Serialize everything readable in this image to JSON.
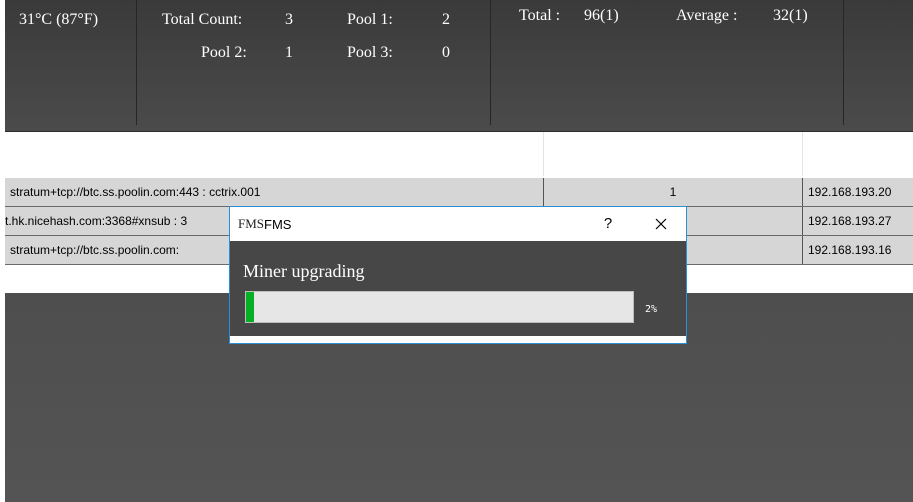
{
  "stats": {
    "temperature": "31°C (87°F)",
    "total_count_label": "Total Count:",
    "total_count_value": "3",
    "pool1_label": "Pool 1:",
    "pool1_value": "2",
    "pool2_label": "Pool 2:",
    "pool2_value": "1",
    "pool3_label": "Pool 3:",
    "pool3_value": "0",
    "total_label": "Total :",
    "total_value": "96(1)",
    "average_label": "Average :",
    "average_value": "32(1)"
  },
  "rows": [
    {
      "pool": "stratum+tcp://btc.ss.poolin.com:443 : cctrix.001",
      "count": "1",
      "ip": "192.168.193.20"
    },
    {
      "pool": "t.hk.nicehash.com:3368#xnsub : 3",
      "count": "",
      "ip": "192.168.193.27"
    },
    {
      "pool": "stratum+tcp://btc.ss.poolin.com:",
      "count": "",
      "ip": "192.168.193.16"
    }
  ],
  "dialog": {
    "logo": "FMS",
    "title": "FMS",
    "help": "?",
    "message": "Miner upgrading",
    "progress_percent": 2,
    "progress_label": "2%"
  },
  "colors": {
    "accent_border": "#2b8fd6",
    "progress_fill": "#06b025"
  }
}
